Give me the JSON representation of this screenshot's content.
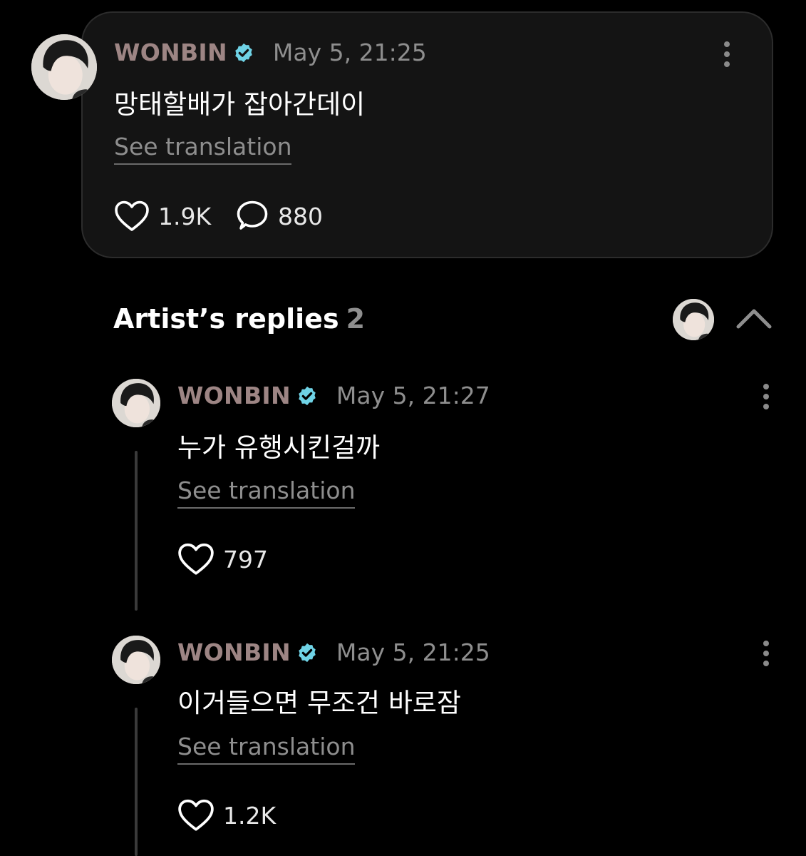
{
  "post": {
    "author": "WONBIN",
    "timestamp": "May 5, 21:25",
    "text": "망태할배가 잡아간데이",
    "see_translation": "See translation",
    "likes": "1.9K",
    "comments": "880"
  },
  "replies_section": {
    "title": "Artist’s replies",
    "count": "2"
  },
  "replies": [
    {
      "author": "WONBIN",
      "timestamp": "May 5, 21:27",
      "text": "누가 유행시킨걸까",
      "see_translation": "See translation",
      "likes": "797"
    },
    {
      "author": "WONBIN",
      "timestamp": "May 5, 21:25",
      "text": "이거들으면 무조건 바로잠",
      "see_translation": "See translation",
      "likes": "1.2K"
    }
  ],
  "colors": {
    "background": "#000000",
    "card": "#141414",
    "author_name": "#9d8584",
    "verified_badge": "#6fd3e6",
    "muted_text": "#8e8e8e"
  },
  "icons": {
    "verified": "verified-badge-icon",
    "more": "kebab-menu-icon",
    "like": "heart-outline-icon",
    "comment": "speech-bubble-icon",
    "collapse": "chevron-up-icon"
  }
}
